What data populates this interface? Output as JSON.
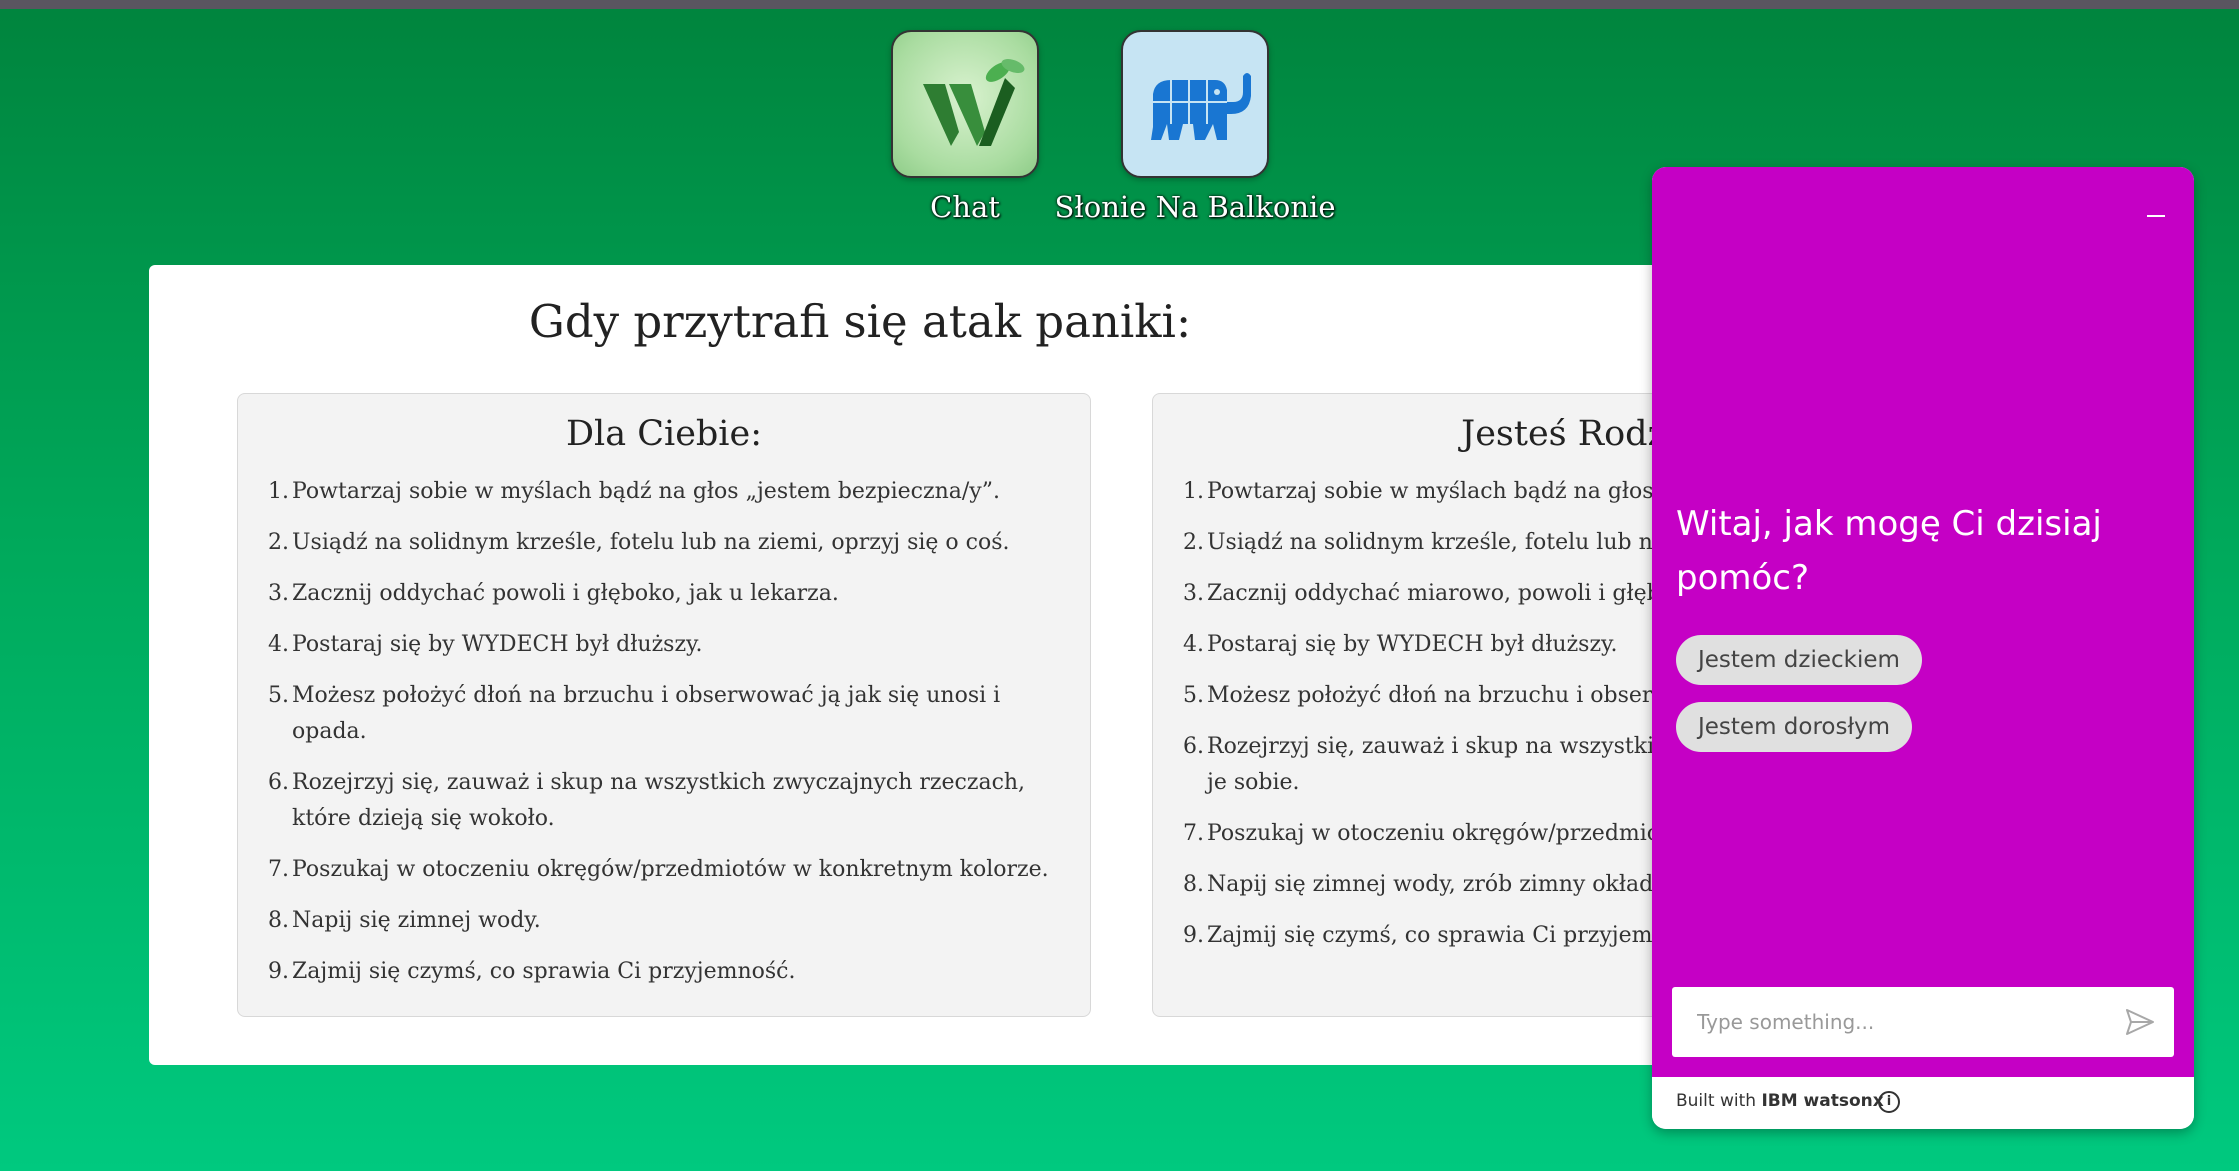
{
  "apps": [
    {
      "label": "Chat",
      "icon": "watsonx-leaf-w-icon"
    },
    {
      "label": "Słonie Na Balkonie",
      "icon": "elephant-icon"
    }
  ],
  "main": {
    "title": "Gdy przytrafi się atak paniki:",
    "panels": [
      {
        "title": "Dla Ciebie:",
        "items": [
          {
            "num": "1.",
            "text": "Powtarzaj sobie w myślach bądź na głos „jestem bezpieczna/y”."
          },
          {
            "num": "2.",
            "text": "Usiądź na solidnym krześle, fotelu lub na ziemi, oprzyj się o coś."
          },
          {
            "num": "3.",
            "text": "Zacznij oddychać powoli i głęboko, jak u lekarza."
          },
          {
            "num": "4.",
            "text": "Postaraj się by WYDECH był dłuższy."
          },
          {
            "num": "5.",
            "text": "Możesz położyć dłoń na brzuchu i obserwować ją jak się unosi i opada."
          },
          {
            "num": "6.",
            "text": "Rozejrzyj się, zauważ i skup na wszystkich zwyczajnych rzeczach, które dzieją się wokoło."
          },
          {
            "num": "7.",
            "text": "Poszukaj w otoczeniu okręgów/przedmiotów w konkretnym kolorze."
          },
          {
            "num": "8.",
            "text": "Napij się zimnej wody."
          },
          {
            "num": "9.",
            "text": "Zajmij się czymś, co sprawia Ci przyjemność."
          }
        ]
      },
      {
        "title": "Jesteś Rodzic",
        "items": [
          {
            "num": "1.",
            "text": "Powtarzaj sobie w myślach bądź na głos „je"
          },
          {
            "num": "2.",
            "text": "Usiądź na solidnym krześle, fotelu lub na zi"
          },
          {
            "num": "3.",
            "text": "Zacznij oddychać miarowo, powoli i głębok"
          },
          {
            "num": "4.",
            "text": "Postaraj się by WYDECH był dłuższy."
          },
          {
            "num": "5.",
            "text": "Możesz położyć dłoń na brzuchu i obserwo"
          },
          {
            "num": "6.",
            "text": "Rozejrzyj się, zauważ i skup na wszystkich z dzieją się wokoło, nazwij je sobie."
          },
          {
            "num": "7.",
            "text": "Poszukaj w otoczeniu okręgów/przedmiotó"
          },
          {
            "num": "8.",
            "text": "Napij się zimnej wody, zrób zimny okład."
          },
          {
            "num": "9.",
            "text": "Zajmij się czymś, co sprawia Ci przyjemnoś"
          }
        ]
      }
    ]
  },
  "chat": {
    "greeting": "Witaj, jak mogę Ci dzisiaj pomóc?",
    "options": [
      "Jestem dzieckiem",
      "Jestem dorosłym"
    ],
    "input_placeholder": "Type something...",
    "footer_prefix": "Built with",
    "footer_brand": "IBM watsonx",
    "info_glyph": "i"
  },
  "colors": {
    "background_top": "#00843d",
    "background_bottom": "#00c97f",
    "chat_accent": "#c500c5",
    "panel_bg": "#f3f3f3"
  }
}
